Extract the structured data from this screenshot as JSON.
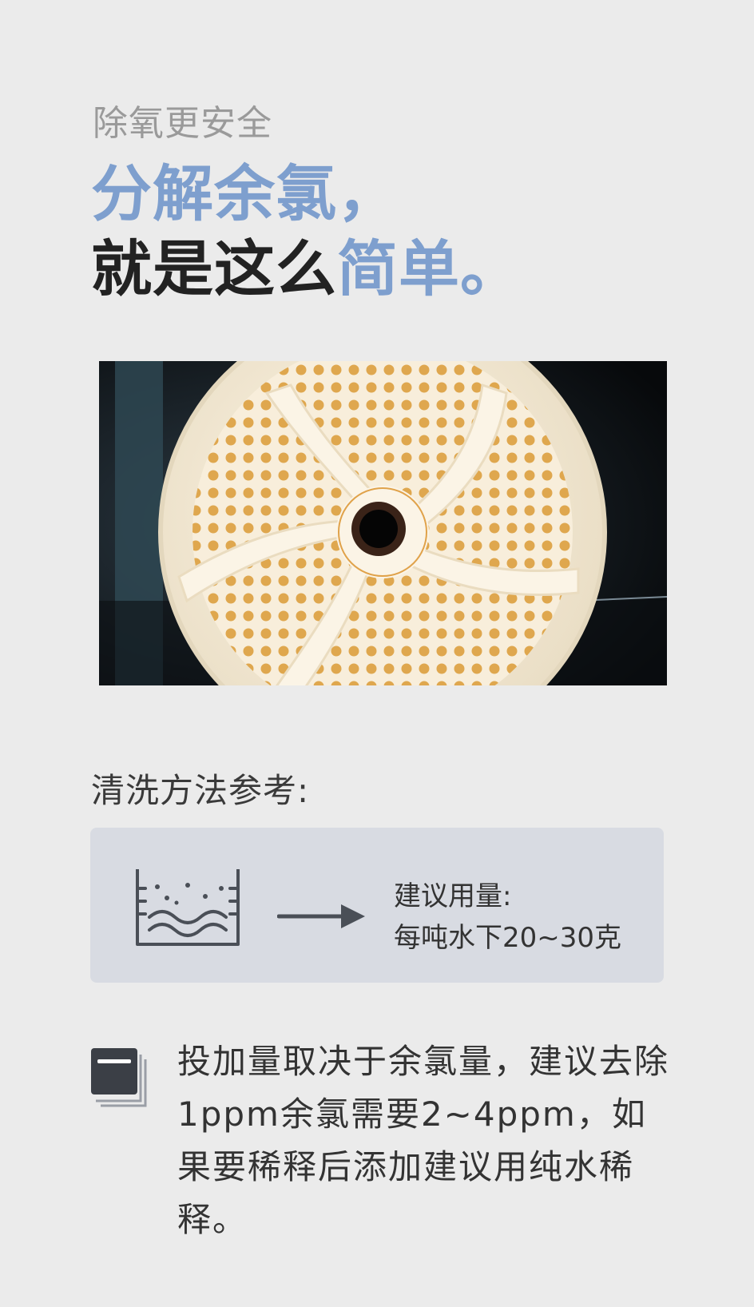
{
  "header": {
    "subtitle": "除氧更安全",
    "headline_line1": "分解余氯，",
    "headline_line2_dark": "就是这么",
    "headline_line2_accent": "简单。"
  },
  "colors": {
    "accent": "#7e9fce",
    "dark_text": "#222222",
    "muted_text": "#9a9a9a",
    "card_bg": "#d8dbe2",
    "page_bg": "#ebebeb"
  },
  "method": {
    "label": "清洗方法参考:"
  },
  "dosage": {
    "icon": "beaker-icon",
    "line1": "建议用量:",
    "line2": "每吨水下20~30克"
  },
  "note": {
    "icon": "document-stack-icon",
    "text": "投加量取决于余氯量，建议去除1ppm余氯需要2~4ppm，如果要稀释后添加建议用纯水稀释。"
  }
}
